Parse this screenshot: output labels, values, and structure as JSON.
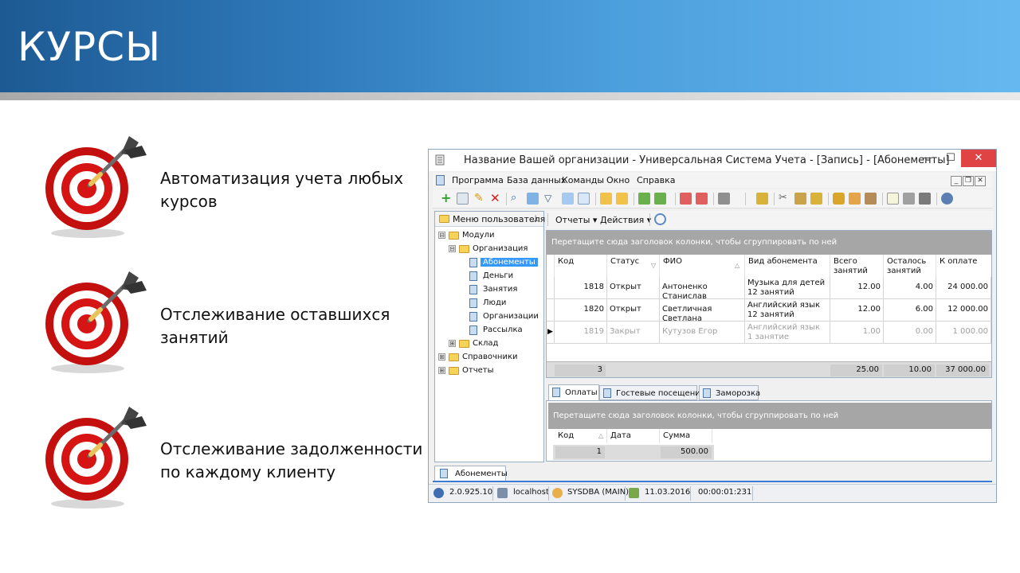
{
  "slide": {
    "title": "КУРСЫ",
    "bullets": [
      {
        "line1": "Автоматизация учета любых",
        "line2": "курсов"
      },
      {
        "line1": "Отслеживание оставшихся",
        "line2": "занятий"
      },
      {
        "line1": "Отслеживание задолженности",
        "line2": "по каждому клиенту"
      }
    ]
  },
  "window": {
    "title": "Название Вашей организации - Универсальная Система Учета - [Запись] - [Абонементы]",
    "controls": {
      "minimize": "—",
      "maximize": "☐",
      "close": "✕"
    },
    "menu": [
      "Программа",
      "База данных",
      "Команды",
      "Окно",
      "Справка"
    ],
    "left_panel": {
      "header": "Меню пользователя",
      "tree": [
        {
          "label": "Модули",
          "level": 0,
          "type": "folder",
          "expander": "⊟"
        },
        {
          "label": "Организация",
          "level": 1,
          "type": "folder",
          "expander": "⊟"
        },
        {
          "label": "Абонементы",
          "level": 2,
          "type": "doc",
          "selected": true
        },
        {
          "label": "Деньги",
          "level": 2,
          "type": "doc"
        },
        {
          "label": "Занятия",
          "level": 2,
          "type": "doc"
        },
        {
          "label": "Люди",
          "level": 2,
          "type": "doc"
        },
        {
          "label": "Организации",
          "level": 2,
          "type": "doc"
        },
        {
          "label": "Рассылка",
          "level": 2,
          "type": "doc"
        },
        {
          "label": "Склад",
          "level": 1,
          "type": "folder",
          "expander": "⊞"
        },
        {
          "label": "Справочники",
          "level": 0,
          "type": "folder",
          "expander": "⊞"
        },
        {
          "label": "Отчеты",
          "level": 0,
          "type": "folder",
          "expander": "⊞"
        }
      ]
    },
    "content_toolbar": {
      "reports": "Отчеты ▾",
      "actions": "Действия ▾"
    },
    "grid": {
      "group_hint": "Перетащите сюда заголовок колонки, чтобы сгруппировать по ней",
      "columns": [
        "Код",
        "Статус",
        "ФИО",
        "Вид абонемента",
        "Всего занятий",
        "Осталось занятий",
        "К оплате"
      ],
      "rows": [
        {
          "code": "1818",
          "status": "Открыт",
          "name": "Антоненко Станислав",
          "kind": "Музыка для детей 12 занятий",
          "total": "12.00",
          "left": "4.00",
          "pay": "24 000.00",
          "closed": false
        },
        {
          "code": "1820",
          "status": "Открыт",
          "name": "Светличная Светлана",
          "kind": "Английский язык 12 занятий",
          "total": "12.00",
          "left": "6.00",
          "pay": "12 000.00",
          "closed": false
        },
        {
          "code": "1819",
          "status": "Закрыт",
          "name": "Кутузов Егор",
          "kind": "Английский язык 1 занятие",
          "total": "1.00",
          "left": "0.00",
          "pay": "1 000.00",
          "closed": true
        }
      ],
      "footer": {
        "count": "3",
        "total": "25.00",
        "left": "10.00",
        "pay": "37 000.00"
      }
    },
    "tabs": [
      "Оплаты",
      "Гостевые посещения",
      "Заморозка"
    ],
    "detail_grid": {
      "group_hint": "Перетащите сюда заголовок колонки, чтобы сгруппировать по ней",
      "columns": [
        "Код",
        "Дата",
        "Сумма"
      ],
      "footer": {
        "count": "1",
        "sum": "500.00"
      }
    },
    "doc_tab": "Абонементы",
    "status": {
      "version": "2.0.925.10",
      "host": "localhost",
      "user": "SYSDBA (MAIN)",
      "date": "11.03.2016",
      "time": "00:00:01:231"
    }
  }
}
